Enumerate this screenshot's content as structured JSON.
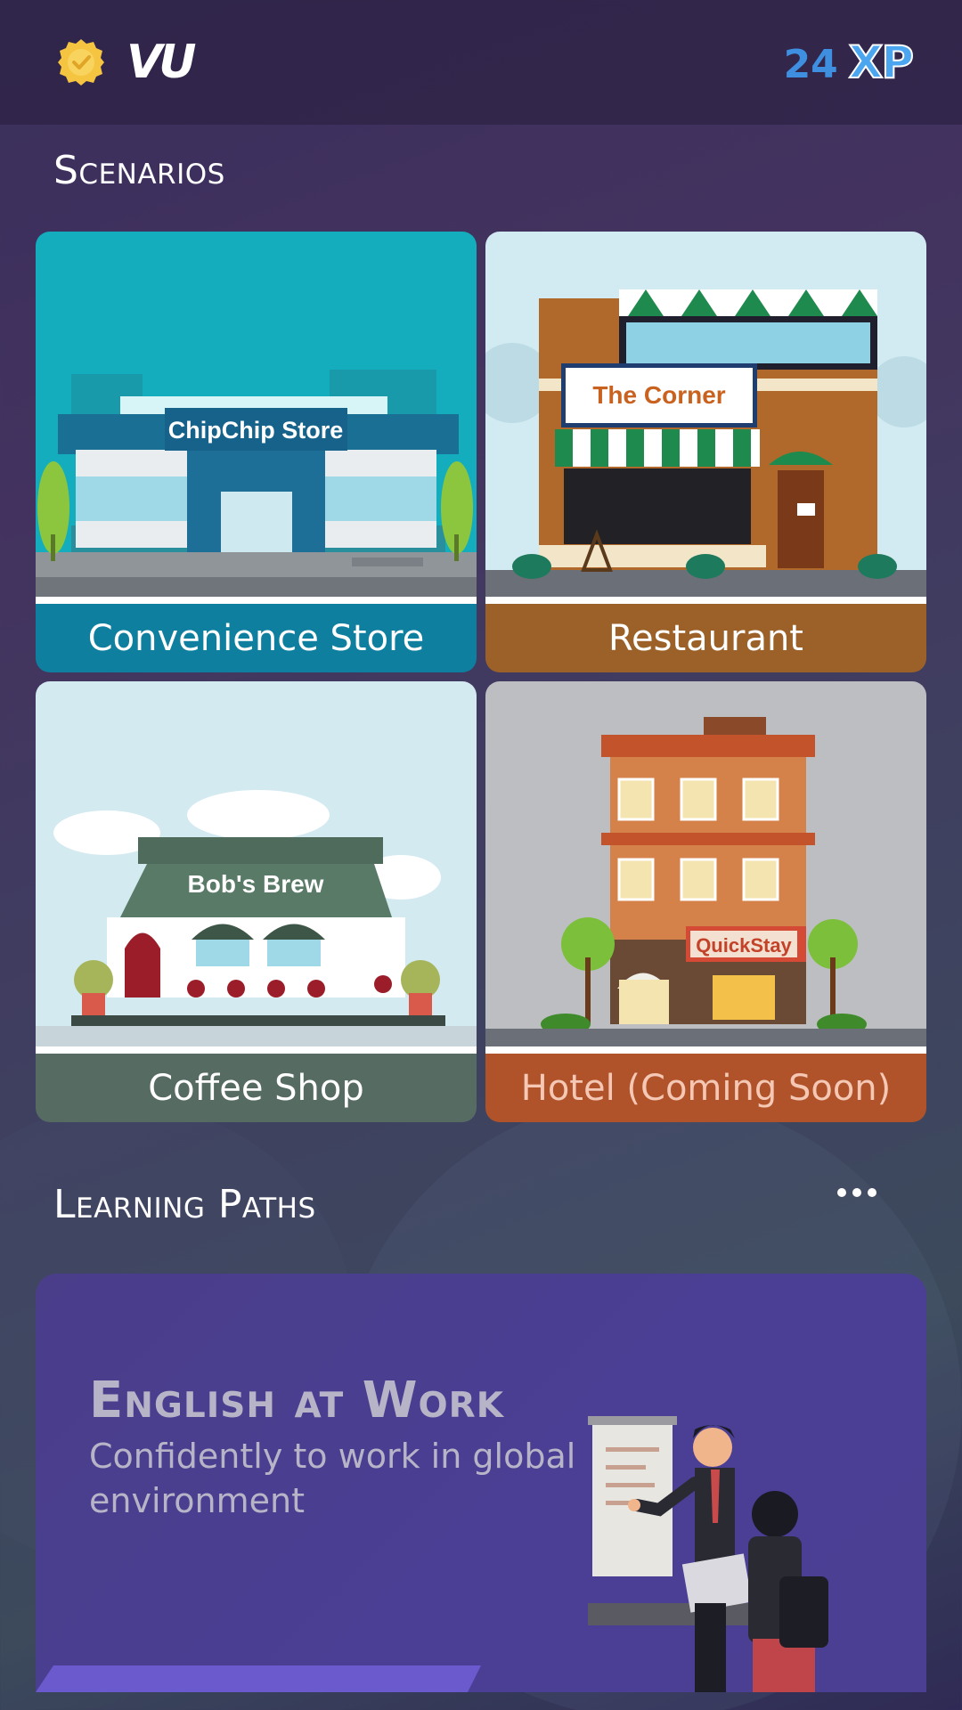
{
  "header": {
    "logo_text": "VU",
    "xp_value": "24",
    "xp_label": "XP",
    "badge_icon": "verified-badge-icon"
  },
  "scenarios": {
    "title": "Scenarios",
    "cards": [
      {
        "label": "Convenience Store",
        "sign": "ChipChip Store",
        "color": "#0f7fa0"
      },
      {
        "label": "Restaurant",
        "sign": "The Corner",
        "color": "#9b6128"
      },
      {
        "label": "Coffee Shop",
        "sign": "Bob's Brew",
        "color": "#566b62"
      },
      {
        "label": "Hotel (Coming Soon)",
        "sign": "QuickStay",
        "color": "#b0532a"
      }
    ]
  },
  "learning_paths": {
    "title": "Learning Paths",
    "more_icon": "more-horizontal-icon",
    "card": {
      "title": "English at Work",
      "subtitle": "Confidently to work in global environment"
    }
  }
}
